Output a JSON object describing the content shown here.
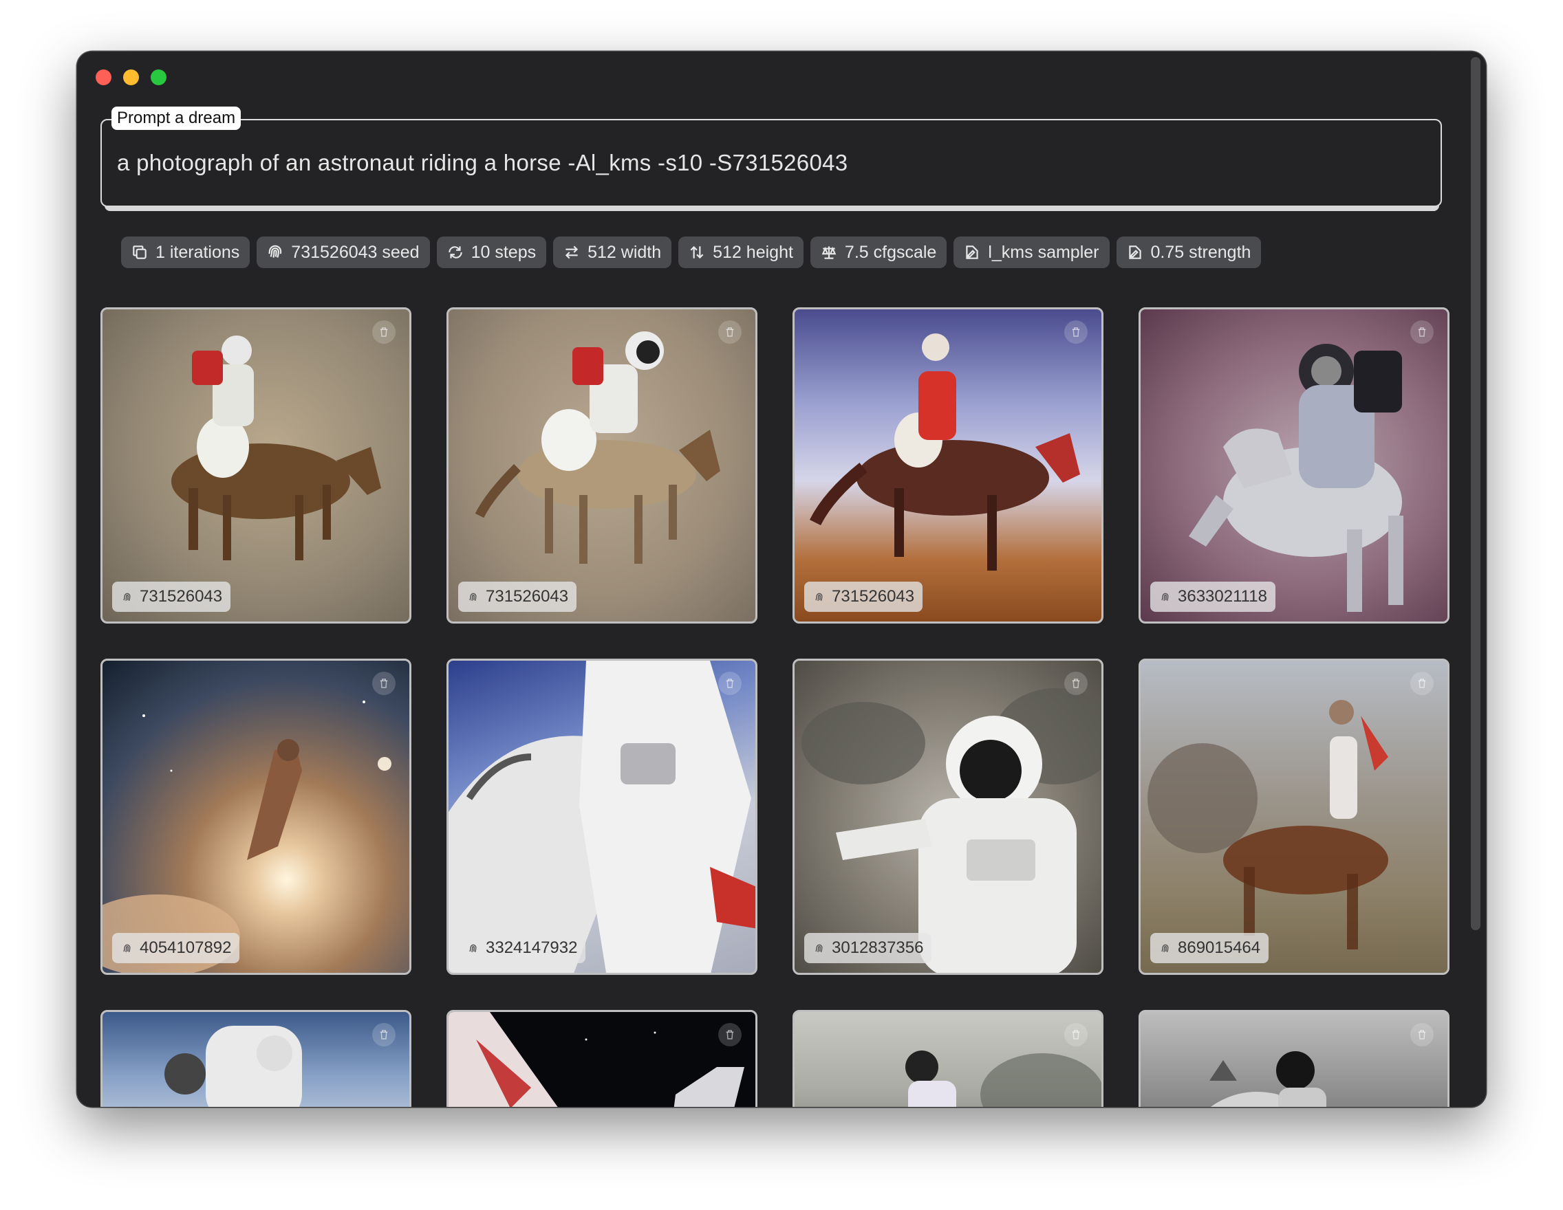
{
  "window": {
    "controls": [
      "close",
      "minimize",
      "maximize"
    ]
  },
  "prompt": {
    "label": "Prompt a dream",
    "value": "a photograph of an astronaut riding a horse -Al_kms -s10 -S731526043"
  },
  "chips": [
    {
      "label": "1 iterations",
      "icon": "copy-icon"
    },
    {
      "label": "731526043 seed",
      "icon": "fingerprint-icon"
    },
    {
      "label": "10 steps",
      "icon": "repeat-icon"
    },
    {
      "label": "512 width",
      "icon": "arrows-horizontal-icon"
    },
    {
      "label": "512 height",
      "icon": "arrows-vertical-icon"
    },
    {
      "label": "7.5 cfgscale",
      "icon": "scale-icon"
    },
    {
      "label": "l_kms sampler",
      "icon": "pen-icon"
    },
    {
      "label": "0.75 strength",
      "icon": "pen-icon"
    }
  ],
  "images": [
    {
      "seed": "731526043",
      "scene": "horse-rider-sand"
    },
    {
      "seed": "731526043",
      "scene": "horse-rider-tan"
    },
    {
      "seed": "731526043",
      "scene": "horse-rider-blue-orange"
    },
    {
      "seed": "3633021118",
      "scene": "astronaut-grey-horse"
    },
    {
      "seed": "4054107892",
      "scene": "space-nebula"
    },
    {
      "seed": "3324147932",
      "scene": "astronaut-white-blue-sky"
    },
    {
      "seed": "3012837356",
      "scene": "astronaut-sepia"
    },
    {
      "seed": "869015464",
      "scene": "blurred-polo"
    },
    {
      "seed": "",
      "scene": "astronaut-sky"
    },
    {
      "seed": "",
      "scene": "dark-space"
    },
    {
      "seed": "",
      "scene": "astronaut-foggy"
    },
    {
      "seed": "",
      "scene": "astronaut-grey-clouds"
    }
  ],
  "colors": {
    "window_bg": "#232325",
    "chip_bg": "#4a4b4f",
    "close": "#fe5f57",
    "minimize": "#febc2e",
    "maximize": "#28c840"
  }
}
